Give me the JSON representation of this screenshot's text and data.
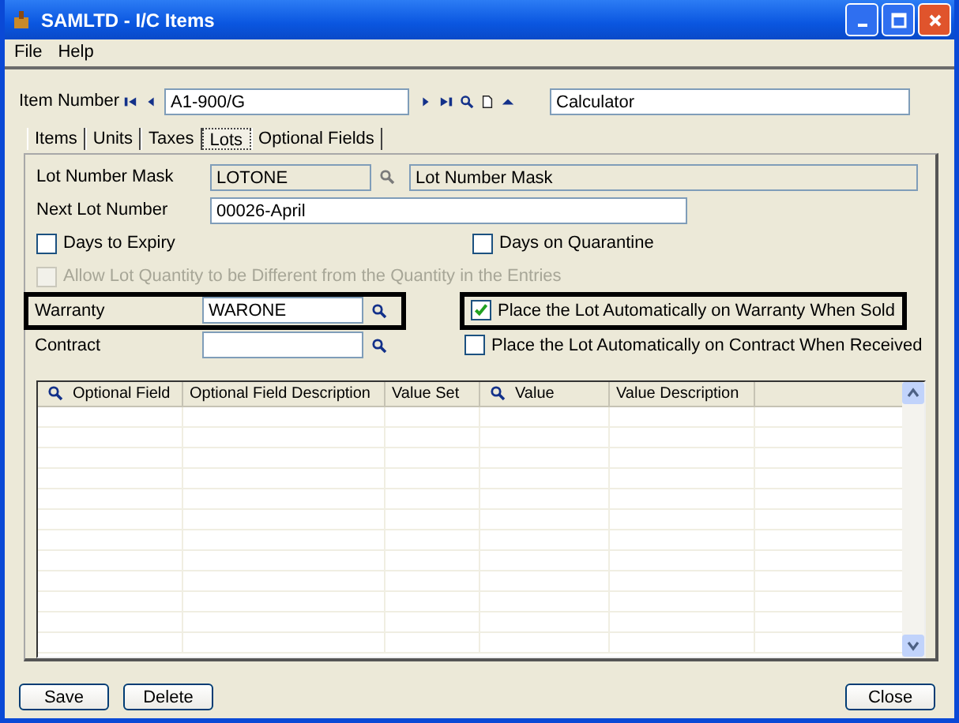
{
  "window": {
    "title": "SAMLTD - I/C Items"
  },
  "menu": [
    "File",
    "Help"
  ],
  "item_number": {
    "label": "Item Number",
    "value": "A1-900/G",
    "description": "Calculator"
  },
  "tabs": [
    {
      "label": "Items",
      "selected": false
    },
    {
      "label": "Units",
      "selected": false
    },
    {
      "label": "Taxes",
      "selected": false
    },
    {
      "label": "Lots",
      "selected": true
    },
    {
      "label": "Optional Fields",
      "selected": false
    }
  ],
  "lot_number_mask": {
    "label": "Lot Number Mask",
    "value": "LOTONE",
    "description": "Lot Number Mask"
  },
  "next_lot_number": {
    "label": "Next Lot Number",
    "value": "00026-April"
  },
  "days_to_expiry": {
    "label": "Days to Expiry",
    "checked": false
  },
  "days_on_quarantine": {
    "label": "Days on Quarantine",
    "checked": false
  },
  "allow_lot_quantity": {
    "label": "Allow Lot Quantity to be Different from the Quantity in the Entries",
    "checked": false,
    "disabled": true
  },
  "warranty": {
    "label": "Warranty",
    "value": "WARONE",
    "highlighted": true
  },
  "warranty_auto": {
    "label": "Place the Lot Automatically on Warranty When Sold",
    "checked": true,
    "highlighted": true
  },
  "contract": {
    "label": "Contract",
    "highlighted": false
  },
  "contract_auto": {
    "label": "Place the Lot Automatically on Contract When Received",
    "checked": false,
    "highlighted": false
  },
  "grid": {
    "columns": [
      {
        "label": "Optional Field",
        "searchable": true
      },
      {
        "label": "Optional Field Description",
        "searchable": false
      },
      {
        "label": "Value Set",
        "searchable": false
      },
      {
        "label": "Value",
        "searchable": true
      },
      {
        "label": "Value Description",
        "searchable": false
      }
    ]
  },
  "buttons": [
    {
      "label": "Save"
    },
    {
      "label": "Delete"
    },
    {
      "label": "Close"
    }
  ]
}
